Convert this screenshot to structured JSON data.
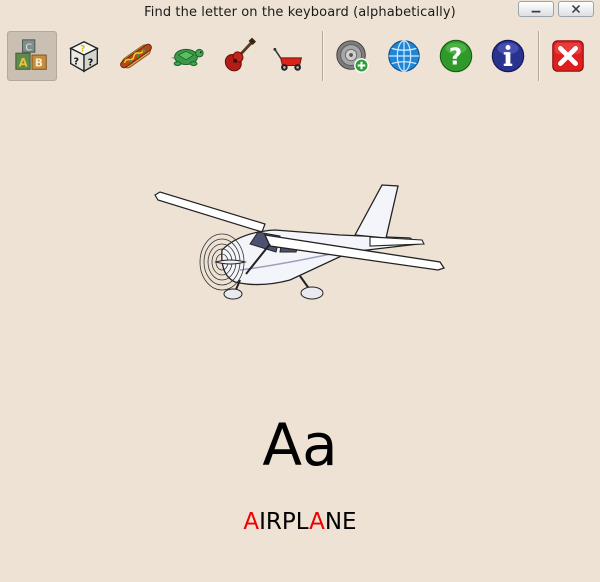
{
  "window": {
    "title": "Find the letter on the keyboard (alphabetically)"
  },
  "toolbar": {
    "items": [
      {
        "name": "letters-blocks",
        "icon": "abc-blocks-icon",
        "active": true
      },
      {
        "name": "random-letters",
        "icon": "question-dice-icon",
        "active": false
      },
      {
        "name": "food-category",
        "icon": "hotdog-icon",
        "active": false
      },
      {
        "name": "animals-category",
        "icon": "turtle-icon",
        "active": false
      },
      {
        "name": "music-category",
        "icon": "guitar-icon",
        "active": false
      },
      {
        "name": "toys-category",
        "icon": "wagon-icon",
        "active": false
      },
      {
        "name": "add-sound",
        "icon": "sound-add-icon",
        "active": false
      },
      {
        "name": "language",
        "icon": "globe-icon",
        "active": false
      },
      {
        "name": "help",
        "icon": "help-icon",
        "active": false
      },
      {
        "name": "about",
        "icon": "info-icon",
        "active": false
      },
      {
        "name": "quit",
        "icon": "close-x-icon",
        "active": false
      }
    ]
  },
  "main": {
    "picture": "airplane-image",
    "letter": "Aa",
    "word": {
      "full": "AIRPLANE",
      "parts": [
        "A",
        "IRPL",
        "A",
        "NE"
      ]
    }
  },
  "colors": {
    "background": "#ede2d4",
    "highlight": "#ee0000",
    "text": "#000000"
  }
}
